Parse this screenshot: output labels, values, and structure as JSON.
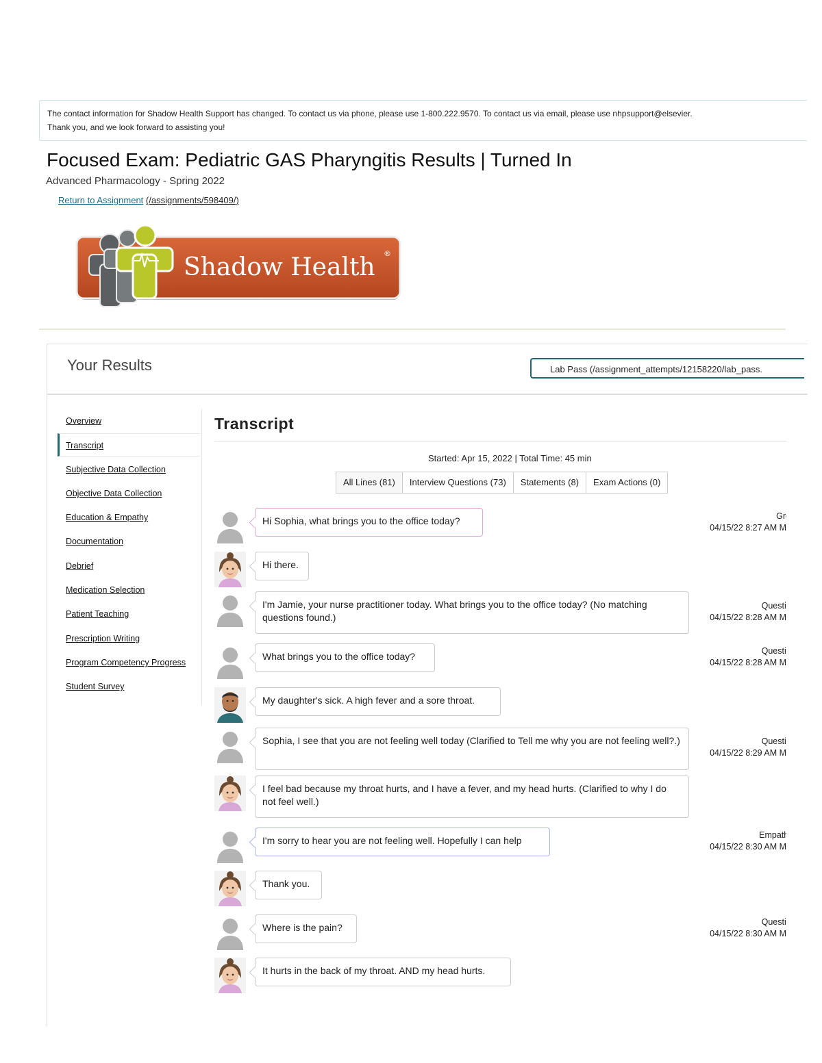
{
  "notice": {
    "line1": "The contact information for Shadow Health Support has changed. To contact us via phone, please use 1-800.222.9570. To contact us via email, please use nhpsupport@elsevier.",
    "line2": "Thank you, and we look forward to assisting you!"
  },
  "page": {
    "title": "Focused Exam: Pediatric GAS Pharyngitis Results | Turned In",
    "subtitle": "Advanced Pharmacology - Spring 2022",
    "return_label": "Return to Assignment",
    "return_path": "(/assignments/598409/)"
  },
  "logo": {
    "text": "Shadow Health",
    "brand_color": "#c9542a",
    "icon_color": "#b7c726"
  },
  "results": {
    "title": "Your Results",
    "lab_pass_label": "Lab Pass (/assignment_attempts/12158220/lab_pass."
  },
  "sidebar": {
    "items": [
      {
        "label": "Overview"
      },
      {
        "label": "Transcript"
      },
      {
        "label": "Subjective Data Collection"
      },
      {
        "label": "Objective Data Collection"
      },
      {
        "label": "Education & Empathy"
      },
      {
        "label": "Documentation"
      },
      {
        "label": "Debrief"
      },
      {
        "label": "Medication Selection"
      },
      {
        "label": "Patient Teaching"
      },
      {
        "label": "Prescription Writing"
      },
      {
        "label": "Program Competency Progress"
      },
      {
        "label": "Student Survey"
      }
    ],
    "active_index": 1
  },
  "transcript": {
    "title": "Transcript",
    "started": "Started: Apr 15, 2022 | Total Time: 45 min",
    "tabs": [
      {
        "label": "All Lines (81)"
      },
      {
        "label": "Interview Questions (73)"
      },
      {
        "label": "Statements (8)"
      },
      {
        "label": "Exam Actions (0)"
      }
    ],
    "messages": [
      {
        "speaker": "student",
        "text": "Hi Sophia, what brings you to the office today?",
        "tag": "Gre",
        "time": "04/15/22 8:27 AM M"
      },
      {
        "speaker": "patient",
        "text": "Hi there.",
        "tag": "",
        "time": ""
      },
      {
        "speaker": "student",
        "text": "I'm Jamie, your nurse practitioner today. What brings you to the office today? (No matching questions found.)",
        "tag": "Questic",
        "time": "04/15/22 8:28 AM M"
      },
      {
        "speaker": "student",
        "text": "What brings you to the office today?",
        "tag": "Questic",
        "time": "04/15/22 8:28 AM M"
      },
      {
        "speaker": "parent",
        "text": "My daughter's sick. A high fever and a sore throat.",
        "tag": "",
        "time": ""
      },
      {
        "speaker": "student",
        "text": "Sophia, I see that you are not feeling well today (Clarified to Tell me why you are not feeling well?.)",
        "tag": "Questic",
        "time": "04/15/22 8:29 AM M"
      },
      {
        "speaker": "patient",
        "text": "I feel bad because my throat hurts, and I have a fever, and my head hurts. (Clarified to why I do not feel well.)",
        "tag": "",
        "time": ""
      },
      {
        "speaker": "student",
        "text": "I'm sorry to hear you are not feeling well. Hopefully I can help",
        "tag": "Empathi",
        "time": "04/15/22 8:30 AM M"
      },
      {
        "speaker": "patient",
        "text": "Thank you.",
        "tag": "",
        "time": ""
      },
      {
        "speaker": "student",
        "text": "Where is the pain?",
        "tag": "Questic",
        "time": "04/15/22 8:30 AM M"
      },
      {
        "speaker": "patient",
        "text": "It hurts in the back of my throat. AND my head hurts.",
        "tag": "",
        "time": ""
      }
    ]
  }
}
